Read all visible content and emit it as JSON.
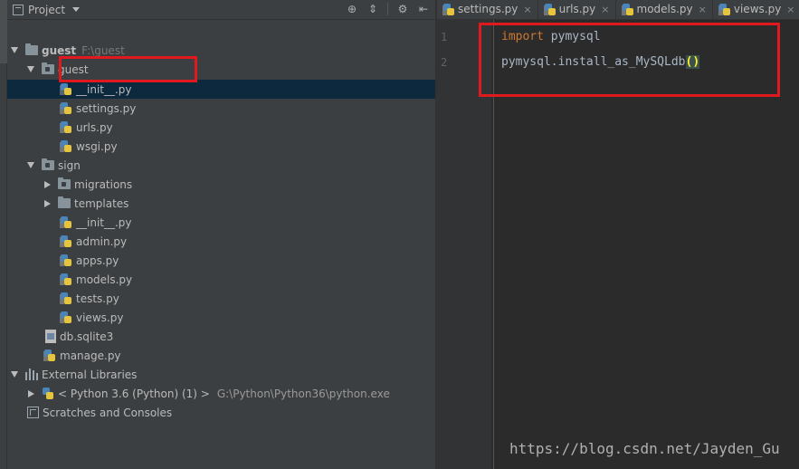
{
  "panel": {
    "title": "Project"
  },
  "tree": {
    "items": [
      {
        "label": "guest",
        "path": "F:\\guest"
      },
      {
        "label": "guest"
      },
      {
        "label": "__init__.py"
      },
      {
        "label": "settings.py"
      },
      {
        "label": "urls.py"
      },
      {
        "label": "wsgi.py"
      },
      {
        "label": "sign"
      },
      {
        "label": "migrations"
      },
      {
        "label": "templates"
      },
      {
        "label": "__init__.py"
      },
      {
        "label": "admin.py"
      },
      {
        "label": "apps.py"
      },
      {
        "label": "models.py"
      },
      {
        "label": "tests.py"
      },
      {
        "label": "views.py"
      },
      {
        "label": "db.sqlite3"
      },
      {
        "label": "manage.py"
      },
      {
        "label": "External Libraries"
      },
      {
        "label": "< Python 3.6 (Python) (1) >",
        "path": "G:\\Python\\Python36\\python.exe"
      },
      {
        "label": "Scratches and Consoles"
      }
    ]
  },
  "tabs": [
    {
      "label": "settings.py",
      "close": "×"
    },
    {
      "label": "urls.py",
      "close": "×"
    },
    {
      "label": "models.py",
      "close": "×"
    },
    {
      "label": "views.py",
      "close": "×"
    }
  ],
  "editor": {
    "line_numbers": [
      "1",
      "2"
    ],
    "line1_keyword": "import",
    "line1_rest": " pymysql",
    "line2_text": "pymysql.install_as_MySQLdb",
    "line2_parens": "()"
  },
  "watermark": "https://blog.csdn.net/Jayden_Gu",
  "colors": {
    "highlight_box": "#e0191e",
    "selection": "#0d293e",
    "keyword": "#cc7832"
  }
}
